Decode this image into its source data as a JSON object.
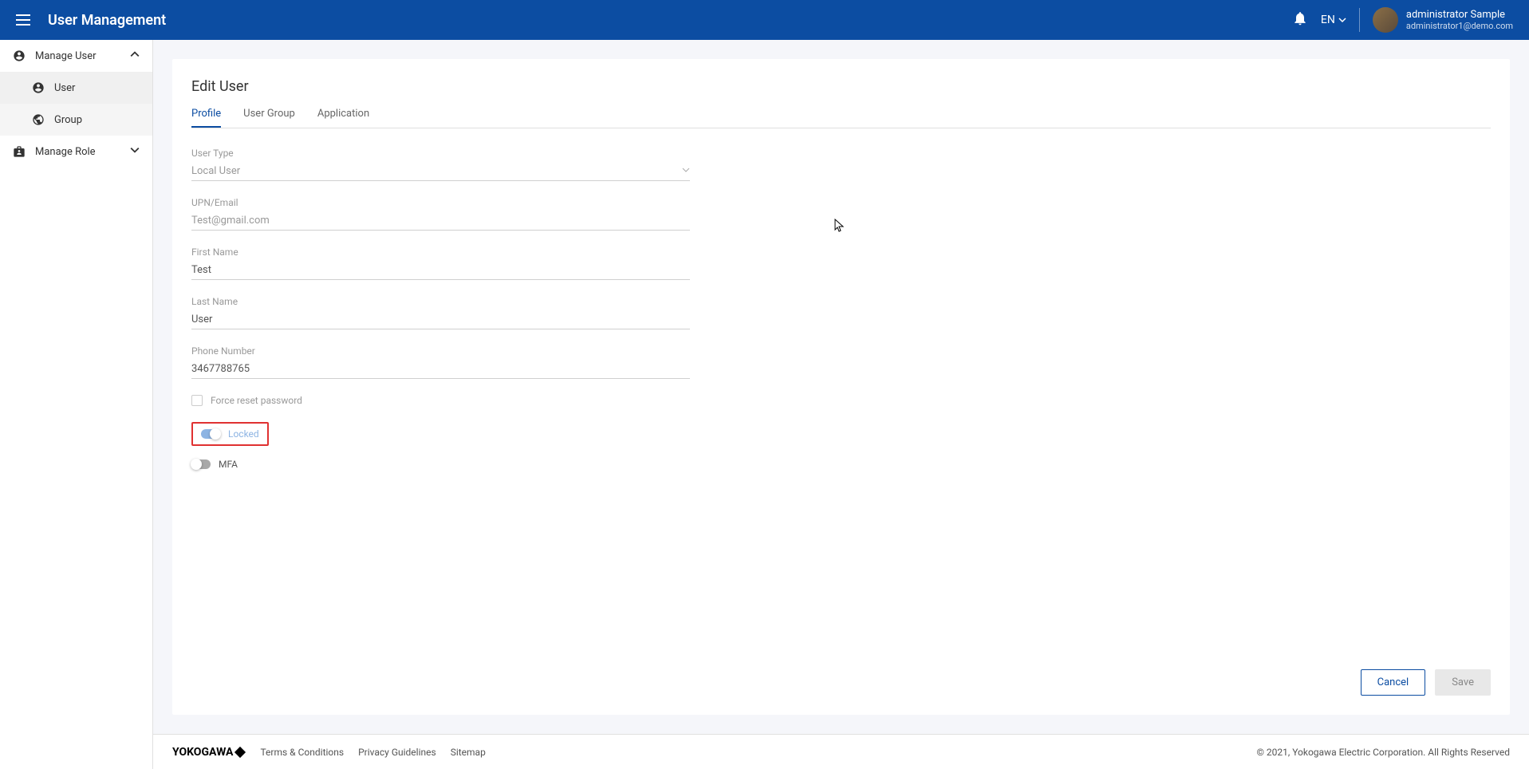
{
  "header": {
    "title": "User Management",
    "language": "EN",
    "user_name": "administrator Sample",
    "user_email": "administrator1@demo.com"
  },
  "sidebar": {
    "manage_user": "Manage User",
    "user": "User",
    "group": "Group",
    "manage_role": "Manage Role"
  },
  "page": {
    "title": "Edit User",
    "tabs": {
      "profile": "Profile",
      "user_group": "User Group",
      "application": "Application"
    }
  },
  "form": {
    "user_type_label": "User Type",
    "user_type_value": "Local User",
    "upn_label": "UPN/Email",
    "upn_value": "Test@gmail.com",
    "first_name_label": "First Name",
    "first_name_value": "Test",
    "last_name_label": "Last Name",
    "last_name_value": "User",
    "phone_label": "Phone Number",
    "phone_value": "3467788765",
    "force_reset_label": "Force reset password",
    "locked_label": "Locked",
    "mfa_label": "MFA"
  },
  "buttons": {
    "cancel": "Cancel",
    "save": "Save"
  },
  "footer": {
    "brand": "YOKOGAWA",
    "terms": "Terms & Conditions",
    "privacy": "Privacy Guidelines",
    "sitemap": "Sitemap",
    "copyright": "© 2021, Yokogawa Electric Corporation. All Rights Reserved"
  }
}
